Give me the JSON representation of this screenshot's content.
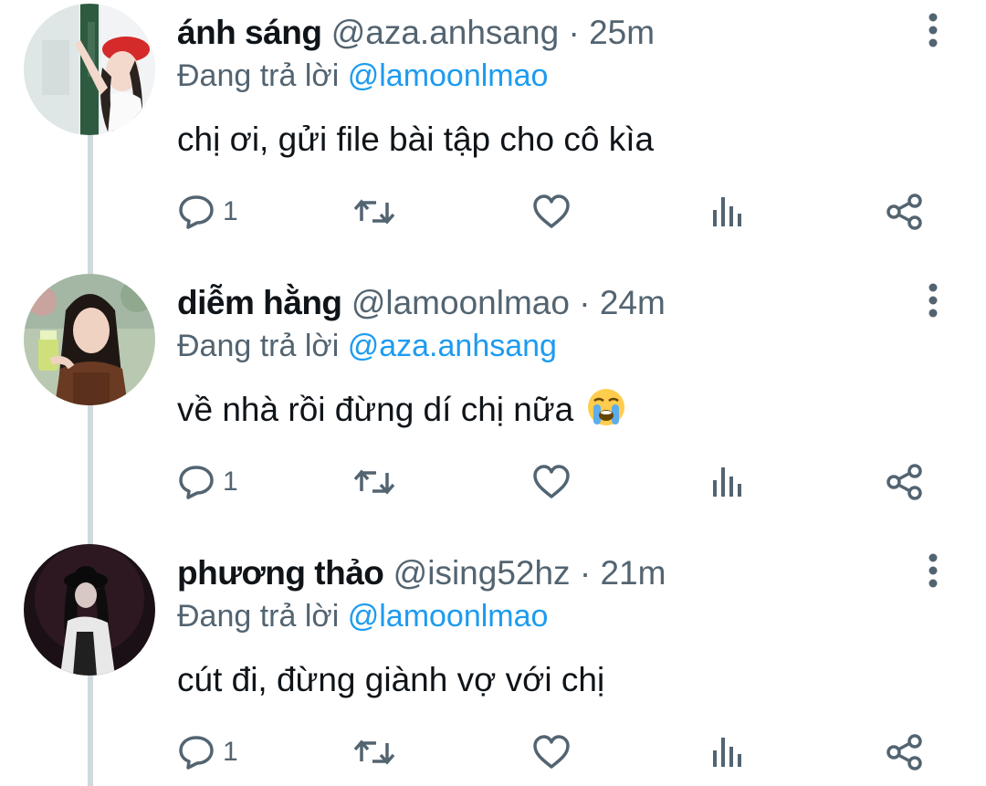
{
  "colors": {
    "text": "#0f1419",
    "secondary": "#536471",
    "link": "#1d9bf0",
    "thread_line": "#cfd9de"
  },
  "icons": {
    "reply": "speech-bubble-icon",
    "retweet": "retweet-arrows-icon",
    "like": "heart-icon",
    "views": "bar-chart-icon",
    "share": "share-nodes-icon",
    "more": "vertical-ellipsis-icon"
  },
  "reply_prefix": "Đang trả lời",
  "tweets": [
    {
      "name": "ánh sáng",
      "handle": "@aza.anhsang",
      "separator": "·",
      "time": "25m",
      "reply_to": "@lamoonlmao",
      "text": "chị ơi, gửi file bài tập cho cô kìa",
      "emoji": "",
      "reply_count": "1"
    },
    {
      "name": "diễm hằng",
      "handle": "@lamoonlmao",
      "separator": "·",
      "time": "24m",
      "reply_to": "@aza.anhsang",
      "text": "về nhà rồi đừng dí chị nữa",
      "emoji": "loudly-crying-face",
      "reply_count": "1"
    },
    {
      "name": "phương thảo",
      "handle": "@ising52hz",
      "separator": "·",
      "time": "21m",
      "reply_to": "@lamoonlmao",
      "text": "cút đi, đừng giành vợ với chị",
      "emoji": "",
      "reply_count": "1"
    }
  ]
}
